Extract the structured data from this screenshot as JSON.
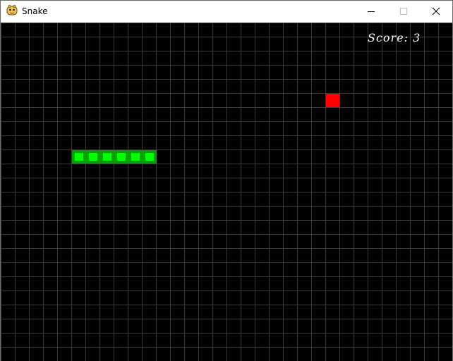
{
  "window": {
    "title": "Snake",
    "icon": "python-snake-icon",
    "controls": [
      "minimize-icon",
      "maximize-icon",
      "close-icon"
    ]
  },
  "game": {
    "score_text": "Score: 3",
    "grid": {
      "columns": 32,
      "rows": 24
    },
    "snake": {
      "direction": "horizontal",
      "segments": [
        {
          "col": 5,
          "row": 9
        },
        {
          "col": 6,
          "row": 9
        },
        {
          "col": 7,
          "row": 9
        },
        {
          "col": 8,
          "row": 9
        },
        {
          "col": 9,
          "row": 9
        },
        {
          "col": 10,
          "row": 9
        }
      ],
      "color_outer": "#00a400",
      "color_inner": "#00ff00"
    },
    "food": {
      "col": 23,
      "row": 5,
      "color": "#ff0000"
    },
    "background_color": "#000000",
    "grid_color": "#3a3a3a"
  }
}
